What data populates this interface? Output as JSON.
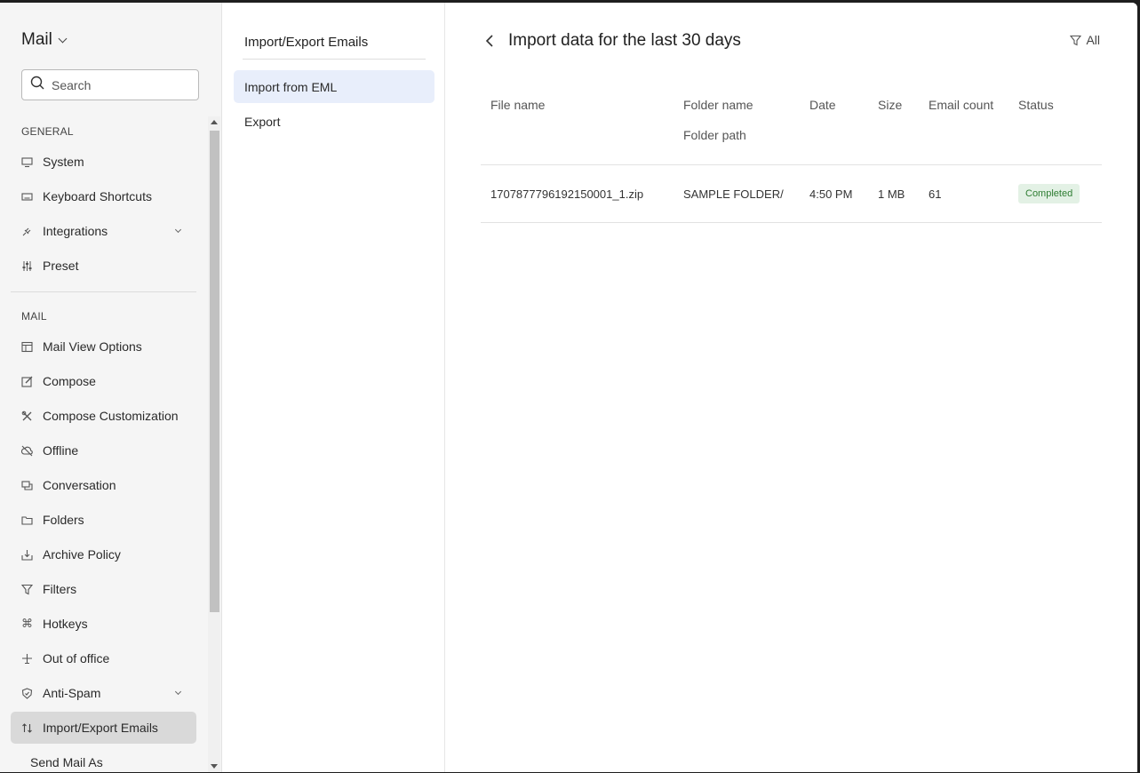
{
  "sidebar": {
    "app_title": "Mail",
    "search_placeholder": "Search",
    "general_label": "GENERAL",
    "mail_label": "MAIL",
    "general_items": [
      {
        "label": "System",
        "icon": "monitor-icon"
      },
      {
        "label": "Keyboard Shortcuts",
        "icon": "keyboard-icon"
      },
      {
        "label": "Integrations",
        "icon": "plug-icon",
        "expandable": true
      },
      {
        "label": "Preset",
        "icon": "sliders-icon"
      }
    ],
    "mail_items": [
      {
        "label": "Mail View Options",
        "icon": "layout-icon"
      },
      {
        "label": "Compose",
        "icon": "edit-icon"
      },
      {
        "label": "Compose Customization",
        "icon": "tools-icon"
      },
      {
        "label": "Offline",
        "icon": "cloud-off-icon"
      },
      {
        "label": "Conversation",
        "icon": "chat-icon"
      },
      {
        "label": "Folders",
        "icon": "folder-icon"
      },
      {
        "label": "Archive Policy",
        "icon": "archive-icon"
      },
      {
        "label": "Filters",
        "icon": "filter-icon"
      },
      {
        "label": "Hotkeys",
        "icon": "command-icon"
      },
      {
        "label": "Out of office",
        "icon": "plane-icon"
      },
      {
        "label": "Anti-Spam",
        "icon": "shield-icon",
        "expandable": true
      },
      {
        "label": "Import/Export Emails",
        "icon": "import-export-icon",
        "active": true
      },
      {
        "label": "Send Mail As",
        "icon": ""
      }
    ]
  },
  "middle": {
    "title": "Import/Export Emails",
    "items": [
      {
        "label": "Import from EML",
        "active": true
      },
      {
        "label": "Export",
        "active": false
      }
    ]
  },
  "main": {
    "title": "Import data for the last 30 days",
    "filter_label": "All",
    "columns": {
      "file_name": "File name",
      "folder_name": "Folder name",
      "folder_path": "Folder path",
      "date": "Date",
      "size": "Size",
      "email_count": "Email count",
      "status": "Status"
    },
    "rows": [
      {
        "file_name": "1707877796192150001_1.zip",
        "folder": "SAMPLE FOLDER/",
        "date": "4:50 PM",
        "size": "1 MB",
        "email_count": "61",
        "status": "Completed"
      }
    ],
    "status_color": "#2e7d32",
    "accent_active": "#e8eefb"
  }
}
